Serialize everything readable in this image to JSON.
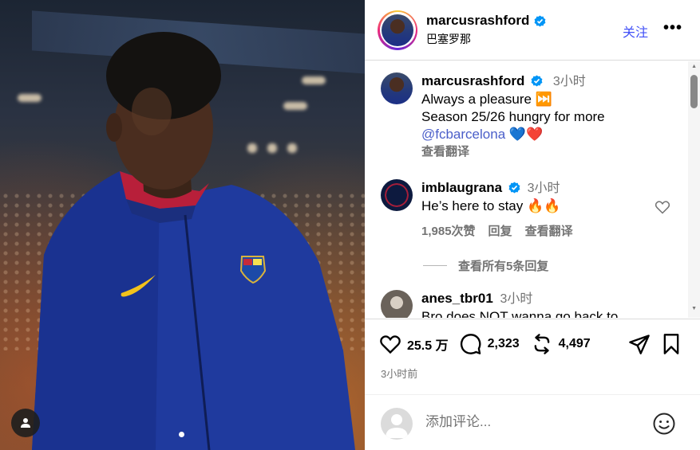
{
  "post": {
    "author": "marcusrashford",
    "location": "巴塞罗那",
    "follow_label": "关注",
    "more_label": "•••"
  },
  "caption": {
    "user": "marcusrashford",
    "time": "3小时",
    "line1": "Always a pleasure ⏭️",
    "line2": "Season 25/26 hungry for more",
    "mention": "@fcbarcelona",
    "hearts": "💙❤️",
    "translate": "查看翻译"
  },
  "comments": [
    {
      "user": "imblaugrana",
      "time": "3小时",
      "text": "He’s here to stay 🔥🔥",
      "likes": "1,985次赞",
      "reply": "回复",
      "translate": "查看翻译"
    },
    {
      "user": "anes_tbr01",
      "time": "3小时",
      "text": "Bro does NOT wanna go back to"
    }
  ],
  "view_replies": "查看所有5条回复",
  "actions": {
    "likes": "25.5 万",
    "comments": "2,323",
    "reposts": "4,497"
  },
  "posted_time": "3小时前",
  "add_comment": {
    "placeholder": "添加评论..."
  },
  "colors": {
    "follow": "#4150f7",
    "verified": "#0095f6",
    "mention": "#4a5ec9",
    "muted": "#737373"
  }
}
